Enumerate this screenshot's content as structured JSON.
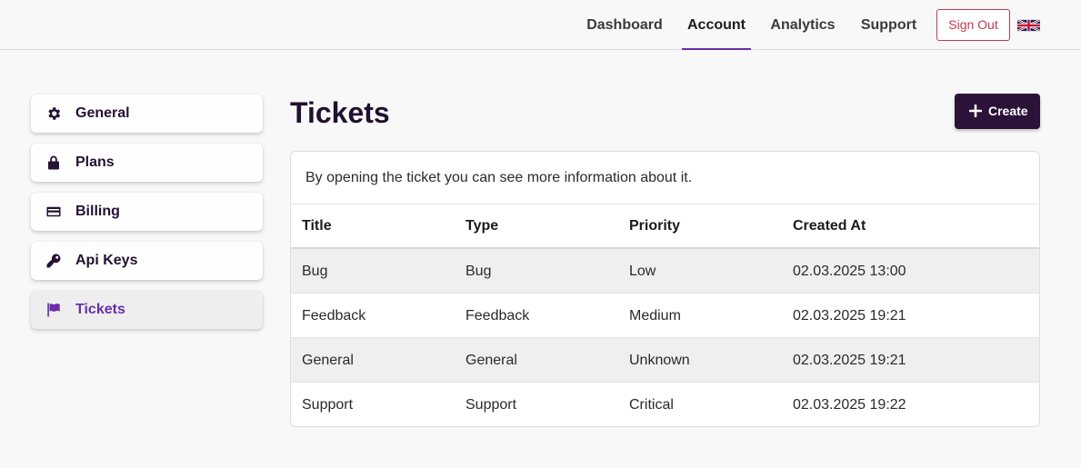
{
  "nav": {
    "links": [
      "Dashboard",
      "Account",
      "Analytics",
      "Support"
    ],
    "active": "Account",
    "sign_out": "Sign Out",
    "language_icon": "uk-flag-icon"
  },
  "sidebar": {
    "items": [
      {
        "label": "General",
        "icon": "gear-icon"
      },
      {
        "label": "Plans",
        "icon": "lock-icon"
      },
      {
        "label": "Billing",
        "icon": "credit-card-icon"
      },
      {
        "label": "Api Keys",
        "icon": "key-icon"
      },
      {
        "label": "Tickets",
        "icon": "flag-icon"
      }
    ],
    "active": "Tickets"
  },
  "main": {
    "title": "Tickets",
    "create_label": "Create",
    "description": "By opening the ticket you can see more information about it.",
    "table": {
      "columns": [
        "Title",
        "Type",
        "Priority",
        "Created At"
      ],
      "rows": [
        [
          "Bug",
          "Bug",
          "Low",
          "02.03.2025 13:00"
        ],
        [
          "Feedback",
          "Feedback",
          "Medium",
          "02.03.2025 19:21"
        ],
        [
          "General",
          "General",
          "Unknown",
          "02.03.2025 19:21"
        ],
        [
          "Support",
          "Support",
          "Critical",
          "02.03.2025 19:22"
        ]
      ]
    }
  },
  "colors": {
    "accent": "#6a2fa8",
    "primary_button": "#2a1238",
    "danger": "#c23b4b"
  }
}
